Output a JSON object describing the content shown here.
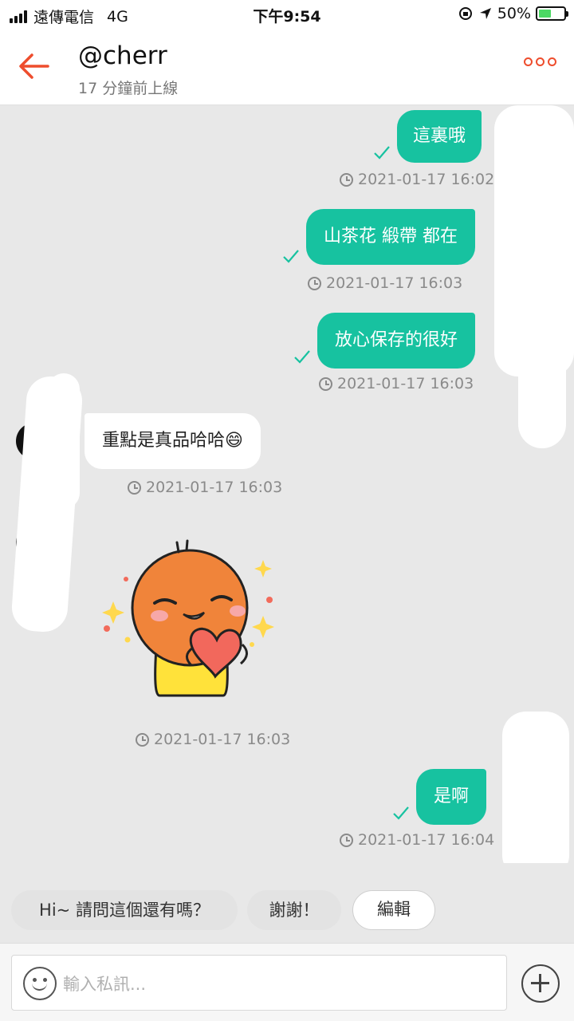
{
  "status_bar": {
    "carrier": "遠傳電信",
    "network": "4G",
    "time": "下午9:54",
    "battery": "50%",
    "battery_level": 0.5
  },
  "header": {
    "username": "@cherr",
    "status": "17 分鐘前上線"
  },
  "messages": [
    {
      "side": "out",
      "text": "這裏哦",
      "time": "2021-01-17 16:02"
    },
    {
      "side": "out",
      "text": "山茶花 緞帶 都在",
      "time": "2021-01-17 16:03"
    },
    {
      "side": "out",
      "text": "放心保存的很好",
      "time": "2021-01-17 16:03"
    },
    {
      "side": "in",
      "text": "重點是真品哈哈😄",
      "time": "2021-01-17 16:03"
    },
    {
      "side": "in",
      "sticker": "heart-sticker",
      "time": "2021-01-17 16:03"
    },
    {
      "side": "out",
      "text": "是啊",
      "time": "2021-01-17 16:04"
    }
  ],
  "quick_replies": [
    "Hi~ 請問這個還有嗎？",
    "謝謝！",
    "編輯"
  ],
  "input": {
    "placeholder": "輸入私訊..."
  },
  "colors": {
    "accent": "#ee4d2d",
    "outgoing_bubble": "#17c2a0",
    "chat_background": "#e8e8e8"
  },
  "icons": [
    "back-arrow-icon",
    "more-options-icon",
    "emoji-icon",
    "plus-icon",
    "clock-icon",
    "check-icon"
  ]
}
